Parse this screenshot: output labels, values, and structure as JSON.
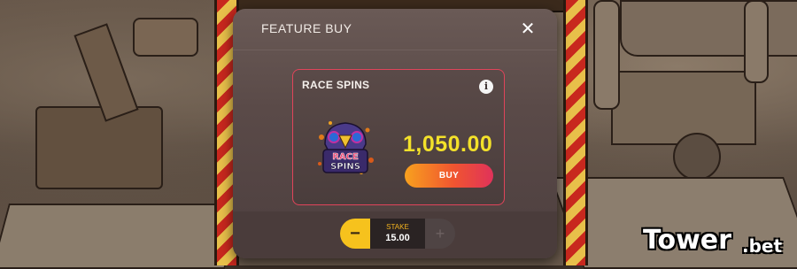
{
  "dialog": {
    "title": "FEATURE BUY",
    "close_icon": "close-icon"
  },
  "feature": {
    "title": "RACE SPINS",
    "info_icon": "info-icon",
    "logo_text_line1": "RACE",
    "logo_text_line2": "SPINS",
    "price": "1,050.00",
    "buy_label": "BUY"
  },
  "stake": {
    "label": "STAKE",
    "value": "15.00",
    "minus_label": "−",
    "plus_label": "+"
  },
  "watermark": {
    "text": "Tower",
    "suffix": ".bet"
  },
  "colors": {
    "price": "#f3e12a",
    "accent_border": "#e0445a",
    "stake_label": "#f2b21f",
    "minus_button": "#f6c21d"
  }
}
